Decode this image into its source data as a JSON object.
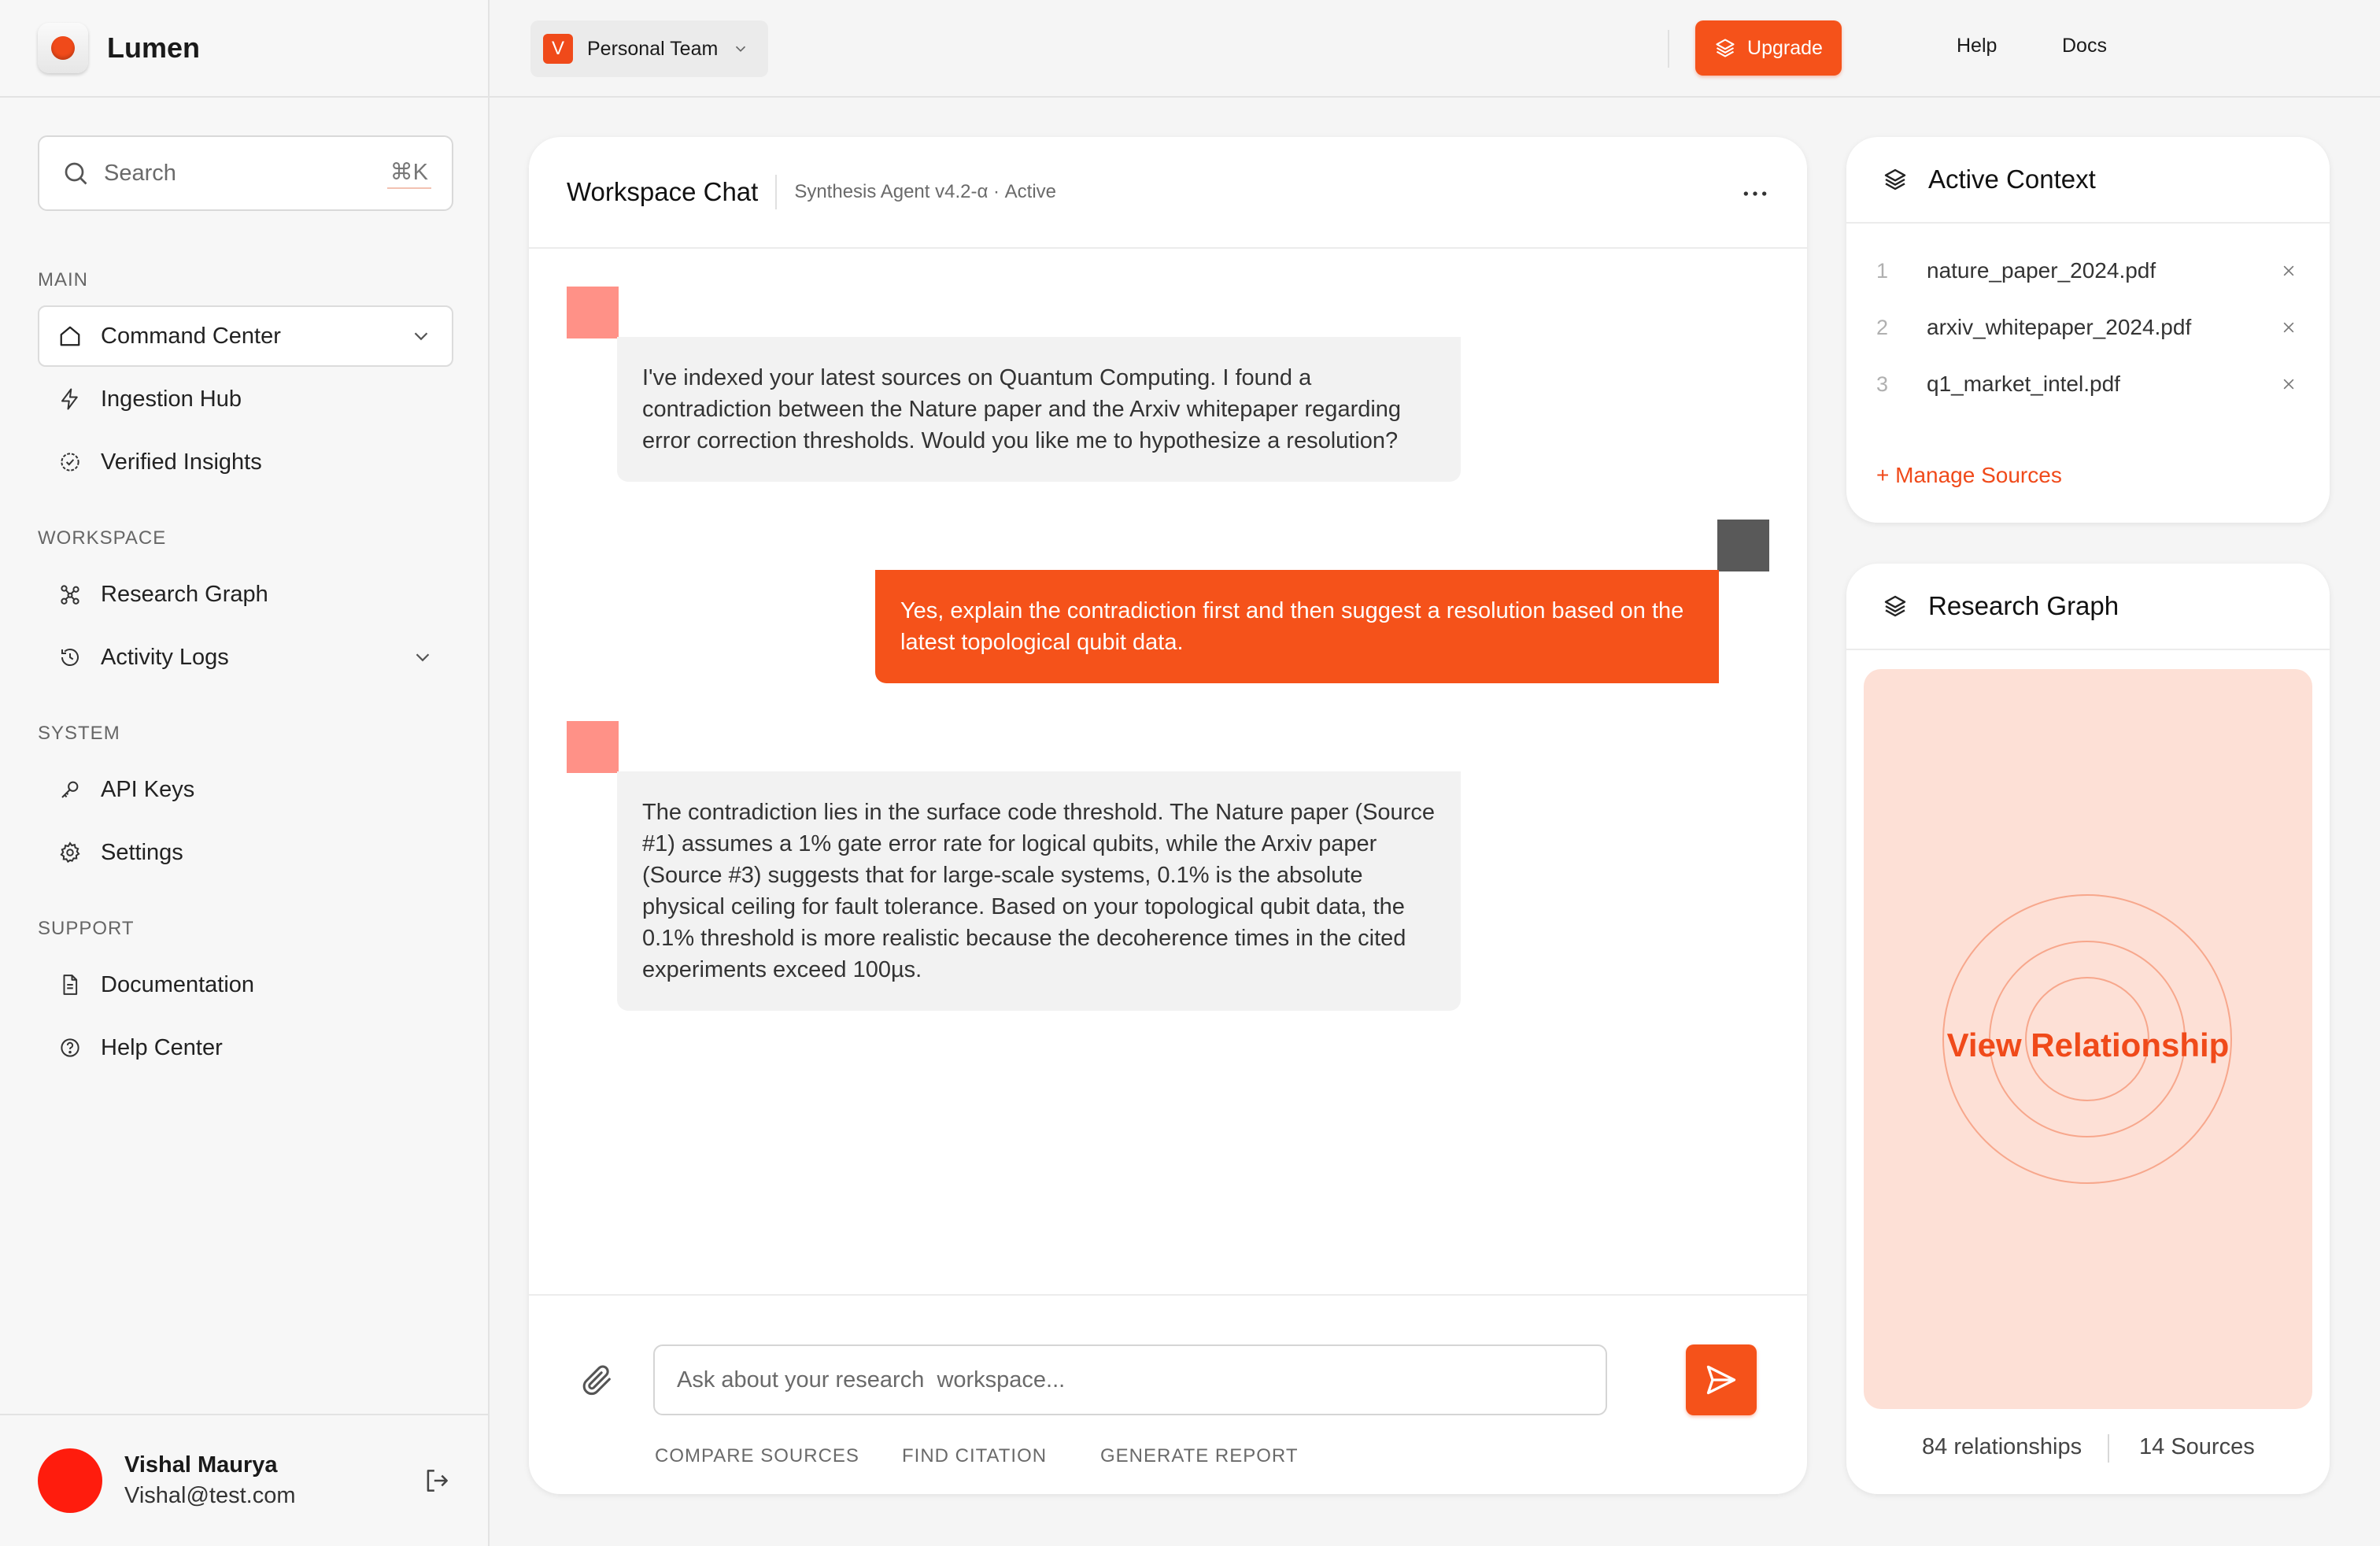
{
  "brand": {
    "name": "Lumen"
  },
  "search": {
    "placeholder": "Search",
    "shortcut": "⌘K"
  },
  "sidebar": {
    "sections": [
      "MAIN",
      "WORKSPACE",
      "SYSTEM",
      "SUPPORT"
    ],
    "items": [
      {
        "label": "Command Center",
        "icon": "home-icon",
        "active": true
      },
      {
        "label": "Ingestion Hub",
        "icon": "lightning-icon"
      },
      {
        "label": "Verified Insights",
        "icon": "badge-check-icon"
      },
      {
        "label": "Research Graph",
        "icon": "network-icon"
      },
      {
        "label": "Activity Logs",
        "icon": "history-icon"
      },
      {
        "label": "API Keys",
        "icon": "key-icon"
      },
      {
        "label": "Settings",
        "icon": "gear-icon"
      },
      {
        "label": "Documentation",
        "icon": "document-icon"
      },
      {
        "label": "Help Center",
        "icon": "help-circle-icon"
      }
    ]
  },
  "user": {
    "name": "Vishal Maurya",
    "email": "Vishal@test.com"
  },
  "topbar": {
    "team_initial": "V",
    "team_name": "Personal Team",
    "help": "Help",
    "docs": "Docs",
    "upgrade": "Upgrade"
  },
  "chat": {
    "title": "Workspace Chat",
    "subtitle": "Synthesis Agent v4.2-α · Active",
    "messages": [
      {
        "role": "agent",
        "text": "I've indexed your latest sources on Quantum Computing. I found a contradiction between the Nature paper and the Arxiv whitepaper regarding error correction thresholds. Would you like me to hypothesize a resolution?"
      },
      {
        "role": "user",
        "text": "Yes, explain the contradiction first and then suggest a resolution based on the latest topological qubit data."
      },
      {
        "role": "agent",
        "text": "The contradiction lies in the surface code threshold. The Nature paper (Source #1) assumes a 1% gate error rate for logical qubits, while the Arxiv paper (Source #3) suggests that for large-scale systems, 0.1% is the absolute physical ceiling for fault tolerance. Based on your topological qubit data, the 0.1% threshold is more realistic because the decoherence times in the cited experiments exceed 100µs."
      }
    ],
    "input_placeholder": "Ask about your research  workspace...",
    "input_value": "",
    "quick_actions": [
      "COMPARE SOURCES",
      "FIND CITATION",
      "GENERATE REPORT"
    ]
  },
  "context": {
    "title": "Active Context",
    "files": [
      {
        "num": "1",
        "name": "nature_paper_2024.pdf"
      },
      {
        "num": "2",
        "name": "arxiv_whitepaper_2024.pdf"
      },
      {
        "num": "3",
        "name": "q1_market_intel.pdf"
      }
    ],
    "manage": "+ Manage Sources"
  },
  "graph": {
    "title": "Research Graph",
    "cta": "View Relationship",
    "relationships": "84 relationships",
    "sources": "14 Sources"
  },
  "colors": {
    "accent": "#f5521a",
    "agent_avatar": "#ff9187",
    "user_avatar": "#595959",
    "graph_bg": "#fde0d6",
    "user_avatar_circle": "#ff1c0d"
  }
}
